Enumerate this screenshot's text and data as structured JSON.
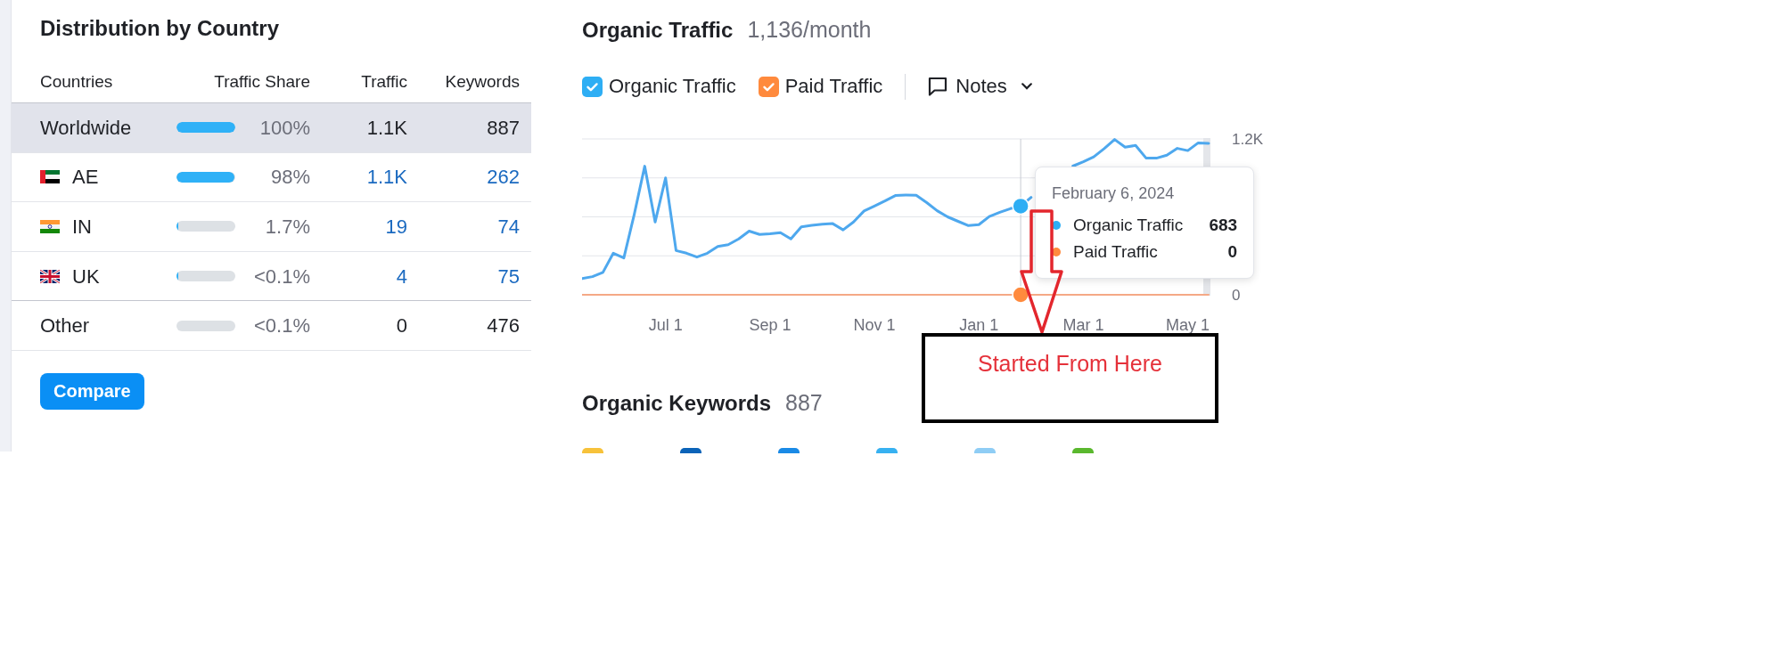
{
  "distribution": {
    "title": "Distribution by Country",
    "columns": [
      "Countries",
      "Traffic Share",
      "Traffic",
      "Keywords"
    ],
    "rows": [
      {
        "kind": "total",
        "country": "Worldwide",
        "selected": true,
        "level": 1,
        "share": "100%",
        "traffic": "1.1K",
        "keywords": "887"
      },
      {
        "kind": "uae",
        "country": "AE",
        "selected": false,
        "level": 0.98,
        "share": "98%",
        "traffic": "1.1K",
        "keywords": "262"
      },
      {
        "kind": "india",
        "country": "IN",
        "selected": false,
        "level": 0.017,
        "share": "1.7%",
        "traffic": "19",
        "keywords": "74"
      },
      {
        "kind": "britain",
        "country": "UK",
        "selected": false,
        "level": 0.01,
        "share": "<0.1%",
        "traffic": "4",
        "keywords": "75"
      },
      {
        "kind": "rest",
        "country": "Other",
        "selected": false,
        "share": "<0.1%",
        "traffic": "0",
        "keywords": "476"
      }
    ],
    "compare_button": "Compare"
  },
  "organic_traffic": {
    "title": "Organic Traffic",
    "total": "1,136/month",
    "series_toggles": [
      {
        "label": "Organic Traffic",
        "checked": true,
        "color": "#2eaef4"
      },
      {
        "label": "Paid Traffic",
        "checked": true,
        "color": "#ff8a3d"
      }
    ],
    "notes_button": "Notes",
    "chart_data": {
      "type": "line",
      "categories": [
        null,
        null,
        null,
        null,
        null,
        null,
        null,
        null,
        "Jul 1",
        null,
        null,
        null,
        null,
        null,
        null,
        null,
        null,
        null,
        "Sep 1",
        null,
        null,
        null,
        null,
        null,
        null,
        null,
        null,
        null,
        "Nov 1",
        null,
        null,
        null,
        null,
        null,
        null,
        null,
        null,
        null,
        "Jan 1",
        null,
        null,
        null,
        null,
        null,
        null,
        null,
        null,
        null,
        "Mar 1",
        null,
        null,
        null,
        null,
        null,
        null,
        null,
        null,
        null,
        "May 1",
        null,
        null
      ],
      "series": [
        {
          "color": "#4ea8ee",
          "values": [
            124,
            140,
            172,
            320,
            283,
            620,
            990,
            560,
            900,
            340,
            320,
            290,
            320,
            372,
            386,
            430,
            490,
            465,
            470,
            478,
            430,
            523,
            534,
            543,
            548,
            500,
            560,
            645,
            683,
            722,
            764,
            768,
            766,
            710,
            647,
            600,
            566,
            533,
            540,
            603,
            635,
            663,
            683,
            750,
            null,
            null,
            null,
            991,
            1024,
            1062,
            1125,
            1196,
            1136,
            1150,
            1053,
            1052,
            1075,
            1127,
            1110,
            1170,
            1166
          ]
        },
        {
          "color": "#f5a986",
          "values": [
            0,
            0,
            0,
            0,
            0,
            0,
            0,
            0,
            0,
            0,
            0,
            0,
            0,
            0,
            0,
            0,
            0,
            0,
            0,
            0,
            0,
            0,
            0,
            0,
            0,
            0,
            0,
            0,
            0,
            0,
            0,
            0,
            0,
            0,
            0,
            0,
            0,
            0,
            0,
            0,
            0,
            0,
            0,
            0,
            0,
            0,
            0,
            0,
            0,
            0,
            0,
            0,
            0,
            0,
            0,
            0,
            0,
            0,
            0,
            0,
            0
          ]
        }
      ],
      "ylim": [
        0,
        1200
      ],
      "yticks": [
        0,
        {
          "value": 1200,
          "label": "1.2K"
        }
      ]
    },
    "tooltip": {
      "date": "February 6, 2024",
      "rows": [
        {
          "label": "Organic Traffic",
          "value": "683",
          "color": "#2eaef4"
        },
        {
          "label": "Paid Traffic",
          "value": "0",
          "color": "#ff8a3d"
        }
      ]
    }
  },
  "organic_keywords": {
    "title": "Organic Keywords",
    "total": "887",
    "legend": [
      {
        "color": "#f7c23a"
      },
      {
        "color": "#0b63b8"
      },
      {
        "color": "#1a8ae6"
      },
      {
        "color": "#37b1f1"
      },
      {
        "color": "#8fcdf5"
      },
      {
        "color": "#5ab82e"
      }
    ]
  },
  "callout": {
    "text": "Started From Here"
  }
}
